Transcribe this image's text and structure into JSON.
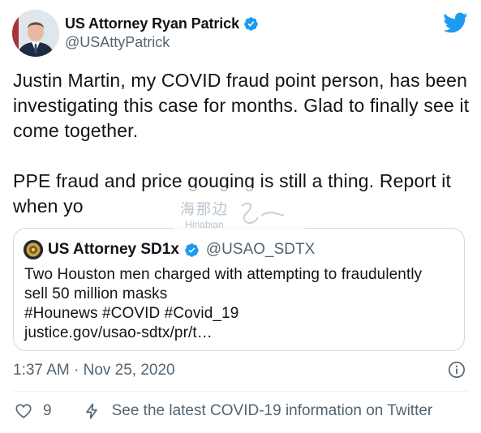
{
  "tweet": {
    "author_name": "US Attorney Ryan Patrick",
    "author_handle": "@USAttyPatrick",
    "paragraphs": [
      "Justin Martin, my COVID fraud point person, has been investigating this case for months. Glad to finally see it come together.",
      "PPE fraud and price gouging is still a thing. Report it when yo"
    ],
    "timestamp": "1:37 AM · Nov 25, 2020",
    "like_count": "9",
    "covid_info": "See the latest COVID-19 information on Twitter"
  },
  "quoted": {
    "author_name": "US Attorney SD1x",
    "author_handle": "@USAO_SDTX",
    "lines": [
      "Two Houston men charged with attempting to fraudulently",
      "sell 50 million masks",
      "#Hounews #COVID #Covid_19",
      "justice.gov/usao-sdtx/pr/t…"
    ]
  },
  "watermark": {
    "cn": "海那边",
    "en": "Hinabian"
  },
  "icons": {
    "twitter": "twitter-bird-icon",
    "verified": "verified-badge-icon",
    "info": "info-icon",
    "like": "heart-icon",
    "covid": "lightning-bolt-icon"
  },
  "colors": {
    "brand": "#1d9bf0",
    "text": "#0f1419",
    "secondary": "#536471",
    "border": "#cfd9de"
  }
}
